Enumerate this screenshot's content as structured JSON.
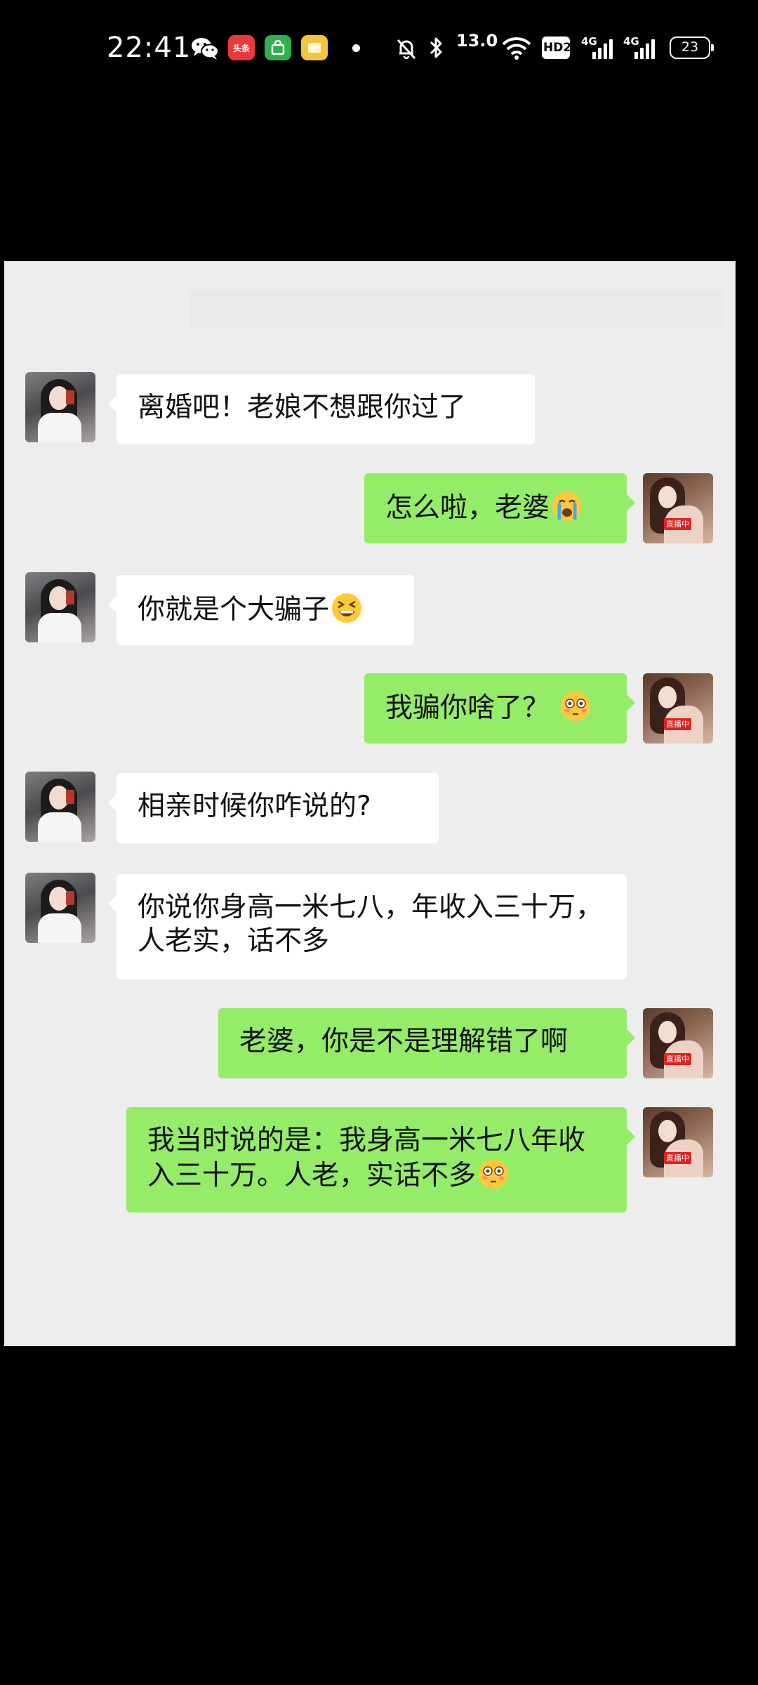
{
  "status_bar": {
    "time": "22:41",
    "network_speed": "13.0",
    "hd_label": "HD2",
    "sim1_label": "4G",
    "sim2_label": "4G",
    "battery": "23",
    "app_icons": [
      "wechat-icon",
      "toutiao-icon",
      "green-app-icon",
      "yellow-app-icon"
    ],
    "toutiao_text": "头条"
  },
  "chat": {
    "live_badge": "直播中",
    "messages": [
      {
        "side": "left",
        "text": "离婚吧！老娘不想跟你过了",
        "emoji": ""
      },
      {
        "side": "right",
        "text": "怎么啦，老婆",
        "emoji": "crying-face"
      },
      {
        "side": "left",
        "text": "你就是个大骗子",
        "emoji": "tired-face"
      },
      {
        "side": "right",
        "text": "我骗你啥了？",
        "emoji": "flushed-face"
      },
      {
        "side": "left",
        "text": "相亲时候你咋说的?",
        "emoji": ""
      },
      {
        "side": "left",
        "text": "你说你身高一米七八，年收入三十万，人老实，话不多",
        "emoji": ""
      },
      {
        "side": "right",
        "text": "老婆，你是不是理解错了啊",
        "emoji": ""
      },
      {
        "side": "right",
        "text": "我当时说的是：我身高一米七八年收入三十万。人老，实话不多",
        "emoji": "flushed-face"
      }
    ]
  },
  "colors": {
    "screen_bg": "#000000",
    "chat_bg": "#ededed",
    "incoming_bubble": "#ffffff",
    "outgoing_bubble": "#95ec69",
    "live_badge": "#e0221f"
  }
}
